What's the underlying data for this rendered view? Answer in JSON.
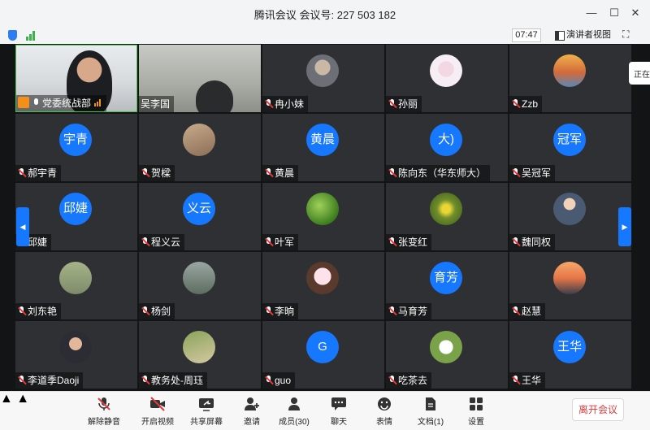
{
  "window": {
    "title": "腾讯会议 会议号: 227 503 182",
    "minimize": "—",
    "maximize": "☐",
    "close": "✕"
  },
  "status": {
    "time": "07:47",
    "view_mode": "演讲者视图",
    "fullscreen_icon": "⛶",
    "edge_tip": "正在"
  },
  "colors": {
    "accent": "#1677ff",
    "leave": "#e4393c",
    "active_speaker": "#47c14a"
  },
  "participants": [
    {
      "name": "党委统战部",
      "type": "video-host"
    },
    {
      "name": "吴李国",
      "type": "video"
    },
    {
      "name": "冉小妹",
      "type": "photo"
    },
    {
      "name": "孙丽",
      "type": "photo"
    },
    {
      "name": "Zzb",
      "type": "photo"
    },
    {
      "name": "郝宇青",
      "type": "text",
      "avatar_text": "宇青"
    },
    {
      "name": "贺樑",
      "type": "photo"
    },
    {
      "name": "黄晨",
      "type": "text",
      "avatar_text": "黄晨"
    },
    {
      "name": "陈向东（华东师大）",
      "type": "text",
      "avatar_text": "大)"
    },
    {
      "name": "吴冠军",
      "type": "text",
      "avatar_text": "冠军"
    },
    {
      "name": "邱婕",
      "type": "text",
      "avatar_text": "邱婕"
    },
    {
      "name": "程义云",
      "type": "text",
      "avatar_text": "义云"
    },
    {
      "name": "叶军",
      "type": "photo"
    },
    {
      "name": "张变红",
      "type": "photo"
    },
    {
      "name": "魏同权",
      "type": "photo"
    },
    {
      "name": "刘东艳",
      "type": "photo"
    },
    {
      "name": "杨剑",
      "type": "photo"
    },
    {
      "name": "李晌",
      "type": "photo"
    },
    {
      "name": "马育芳",
      "type": "text",
      "avatar_text": "育芳"
    },
    {
      "name": "赵慧",
      "type": "photo"
    },
    {
      "name": "李道季Daoji",
      "type": "photo"
    },
    {
      "name": "教务处-周珏",
      "type": "photo"
    },
    {
      "name": "guo",
      "type": "text",
      "avatar_text": "G"
    },
    {
      "name": "吃茶去",
      "type": "photo"
    },
    {
      "name": "王华",
      "type": "text",
      "avatar_text": "王华"
    }
  ],
  "toolbar": {
    "unmute": "解除静音",
    "video": "开启视频",
    "share": "共享屏幕",
    "invite": "邀请",
    "members": "成员(30)",
    "chat": "聊天",
    "reactions": "表情",
    "docs": "文档(1)",
    "settings": "设置",
    "leave": "离开会议"
  }
}
